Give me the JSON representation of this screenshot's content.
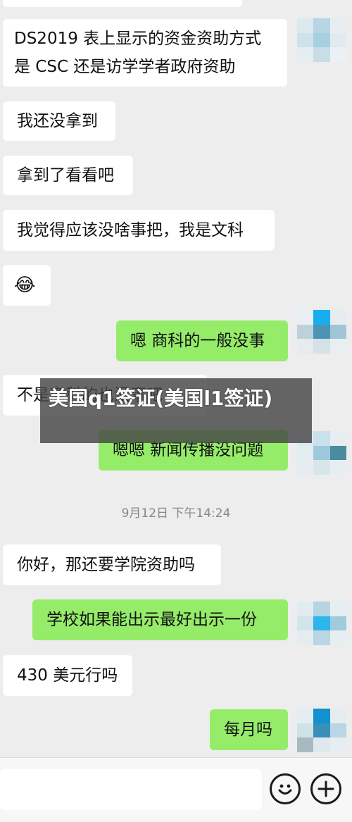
{
  "chat": {
    "messages": [
      {
        "side": "left",
        "line1": "DS2019 表上显示的资金资助方式",
        "line2": "是 CSC 还是访学学者政府资助"
      },
      {
        "side": "left",
        "text": "我还没拿到"
      },
      {
        "side": "left",
        "text": "拿到了看看吧"
      },
      {
        "side": "left",
        "text": "我觉得应该没啥事把，我是文科"
      },
      {
        "side": "left",
        "text": "😂"
      },
      {
        "side": "right",
        "text": "嗯 商科的一般没事"
      },
      {
        "side": "left",
        "text": "不是商科的也没事吧"
      },
      {
        "side": "right",
        "text": "嗯嗯 新闻传播没问题"
      },
      {
        "side": "left",
        "text": "你好，那还要学院资助吗"
      },
      {
        "side": "right",
        "text": "学校如果能出示最好出示一份"
      },
      {
        "side": "left",
        "text": "430 美元行吗"
      },
      {
        "side": "right",
        "text": "每月吗"
      }
    ],
    "timestamp": "9月12日 下午14:24"
  },
  "overlay": {
    "title": "美国q1签证(美国l1签证)"
  },
  "colors": {
    "background": "#ededed",
    "left_bubble": "#ffffff",
    "right_bubble": "#95ec69"
  },
  "input_bar": {
    "emoji_icon": "smiley-icon",
    "add_icon": "plus-icon"
  }
}
